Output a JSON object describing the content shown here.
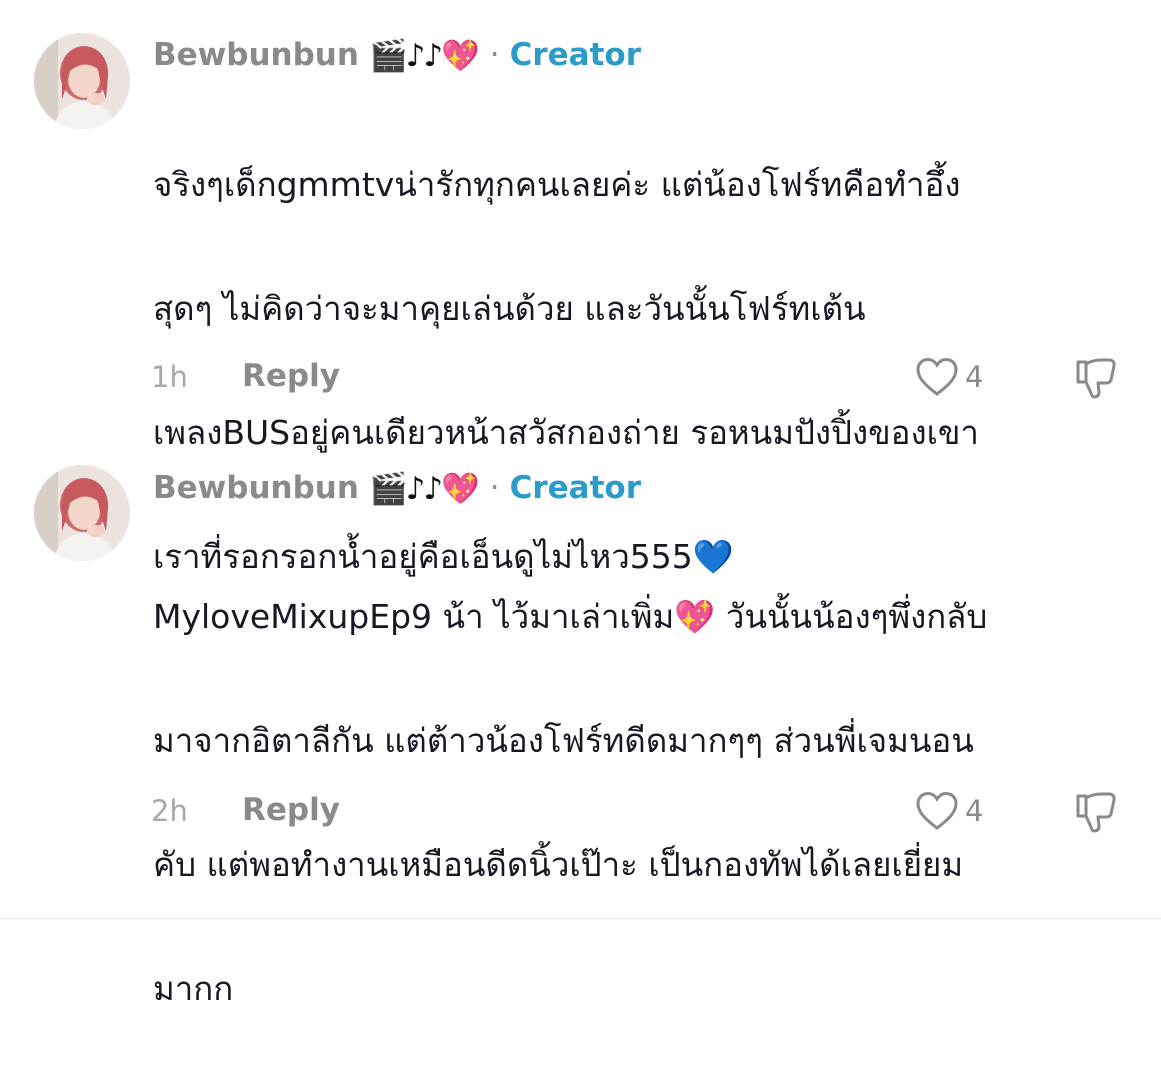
{
  "comments": [
    {
      "username": "Bewbunbun",
      "emojis": {
        "clapper": "🎬",
        "notes": "♪♪",
        "heart": "💖"
      },
      "separator": "·",
      "badge": "Creator",
      "text_lines": [
        "จริงๆเด็กgmmtvน่ารักทุกคนเลยค่ะ แต่น้องโฟร์ทคือทำอึ้ง",
        "สุดๆ ไม่คิดว่าจะมาคุยเล่นด้วย และวันนั้นโฟร์ทเต้น",
        "เพลงBUSอยู่คนเดียวหน้าสวัสกองถ่าย รอหนมปังปิ้งของเขา",
        "เราที่รอกรอกน้ำอยู่คือเอ็นดูไม่ไหว555"
      ],
      "text_emoji": "💙",
      "time": "1h",
      "reply_label": "Reply",
      "likes": "4"
    },
    {
      "username": "Bewbunbun",
      "emojis": {
        "clapper": "🎬",
        "notes": "♪♪",
        "heart": "💖"
      },
      "separator": "·",
      "badge": "Creator",
      "text_line1_a": "MyloveMixupEp9 น้า ไว้มาเล่าเพิ่ม",
      "text_line1_emoji": "💖",
      "text_line1_b": " วันนั้นน้องๆพึ่งกลับ",
      "text_lines_rest": [
        "มาจากอิตาลีกัน แต่ต้าวน้องโฟร์ทดีดมากๆๆ ส่วนพี่เจมนอน",
        "คับ แต่พอทำงานเหมือนดีดนิ้วเป๊าะ เป็นกองทัพได้เลยเยี่ยม",
        "มากก"
      ],
      "time": "2h",
      "reply_label": "Reply",
      "likes": "4"
    }
  ],
  "colors": {
    "username": "#8a8a8a",
    "creator_badge": "#2b9bc7",
    "body_text": "#161823",
    "meta_text": "#a8a8a8"
  },
  "icons": [
    "avatar",
    "heart-outline-icon",
    "thumbs-down-icon"
  ]
}
